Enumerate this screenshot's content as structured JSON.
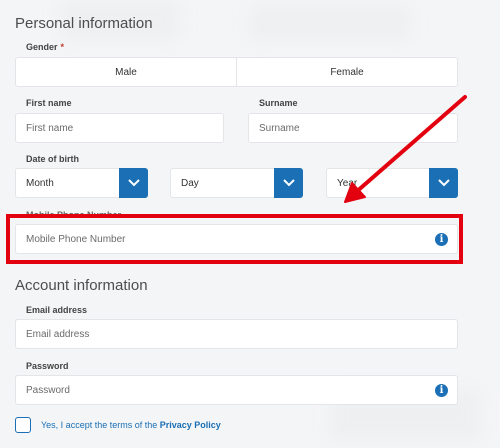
{
  "personal": {
    "title": "Personal information",
    "gender_label": "Gender",
    "gender_required": "*",
    "gender_options": [
      "Male",
      "Female"
    ],
    "first_name_label": "First name",
    "first_name_placeholder": "First name",
    "surname_label": "Surname",
    "surname_placeholder": "Surname",
    "dob_label": "Date of birth",
    "dob_month": "Month",
    "dob_day": "Day",
    "dob_year": "Year",
    "phone_label": "Mobile Phone Number",
    "phone_placeholder": "Mobile Phone Number"
  },
  "account": {
    "title": "Account information",
    "email_label": "Email address",
    "email_placeholder": "Email address",
    "password_label": "Password",
    "password_placeholder": "Password"
  },
  "terms": {
    "prefix": "Yes, I accept the terms of the ",
    "link": "Privacy Policy"
  },
  "icons": {
    "info": "info-icon",
    "chevron": "chevron-down-icon"
  },
  "colors": {
    "accent": "#1a6fb5",
    "highlight": "#e3000f"
  }
}
